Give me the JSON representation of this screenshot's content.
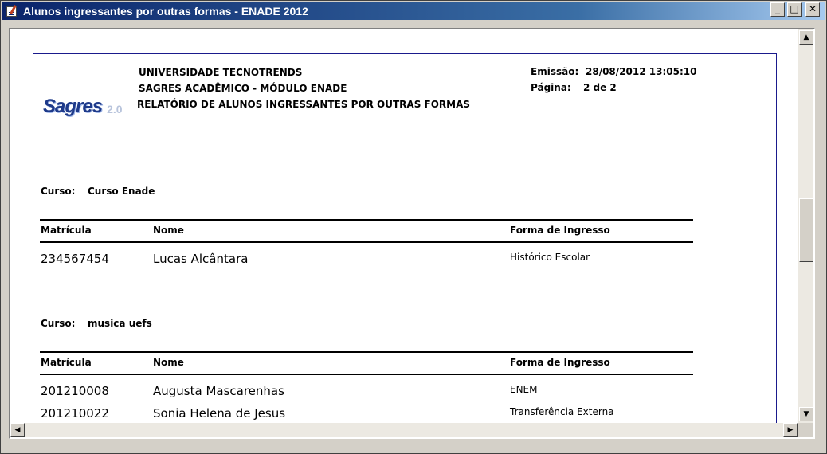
{
  "window": {
    "title": "Alunos ingressantes por outras formas - ENADE  2012"
  },
  "controls": {
    "minimize": "_",
    "maximize": "□",
    "close": "✕"
  },
  "report": {
    "institution": "UNIVERSIDADE TECNOTRENDS",
    "system": "SAGRES ACADÊMICO - MÓDULO ENADE",
    "report_title": "RELATÓRIO DE ALUNOS INGRESSANTES POR OUTRAS FORMAS",
    "emission_label": "Emissão:",
    "emission_value": "28/08/2012 13:05:10",
    "page_label": "Página:",
    "page_value": "2 de 2",
    "logo": {
      "main": "Sagres",
      "version": "2.0"
    },
    "course_label": "Curso:",
    "columns": [
      "Matrícula",
      "Nome",
      "Forma de Ingresso"
    ],
    "groups": [
      {
        "course": "Curso Enade",
        "rows": [
          {
            "matricula": "234567454",
            "nome": "Lucas Alcântara",
            "forma": "Histórico Escolar"
          }
        ]
      },
      {
        "course": "musica uefs",
        "rows": [
          {
            "matricula": "201210008",
            "nome": "Augusta Mascarenhas",
            "forma": "ENEM"
          },
          {
            "matricula": "201210022",
            "nome": "Sonia Helena de Jesus",
            "forma": "Transferência Externa"
          }
        ]
      }
    ]
  },
  "scrollbars": {
    "up": "▲",
    "down": "▼",
    "left": "◀",
    "right": "▶"
  }
}
